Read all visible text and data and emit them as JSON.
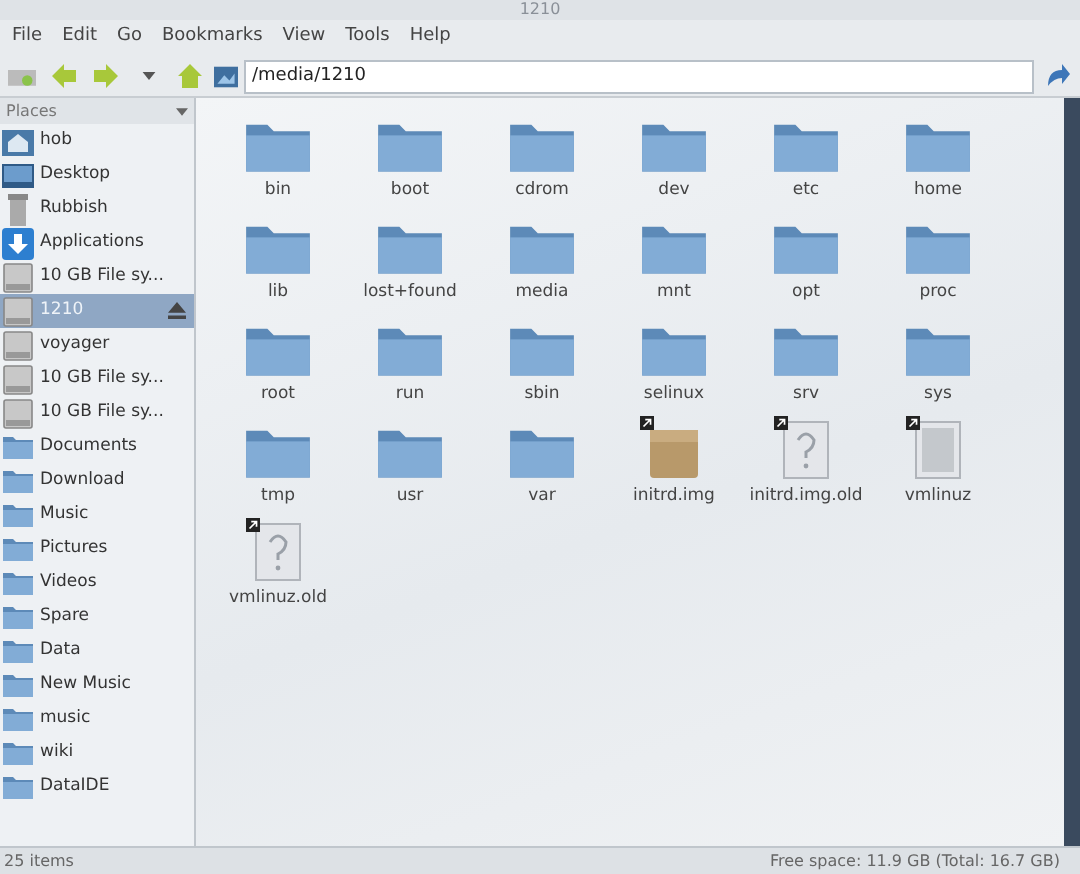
{
  "window": {
    "title": "1210"
  },
  "menu": [
    "File",
    "Edit",
    "Go",
    "Bookmarks",
    "View",
    "Tools",
    "Help"
  ],
  "location": {
    "value": "/media/1210"
  },
  "sidebar": {
    "title": "Places",
    "items": [
      {
        "label": "hob",
        "kind": "home",
        "selected": false
      },
      {
        "label": "Desktop",
        "kind": "desktop",
        "selected": false
      },
      {
        "label": "Rubbish",
        "kind": "trash",
        "selected": false
      },
      {
        "label": "Applications",
        "kind": "apps",
        "selected": false
      },
      {
        "label": "10 GB File sy...",
        "kind": "drive",
        "selected": false
      },
      {
        "label": "1210",
        "kind": "drive",
        "selected": true,
        "eject": true
      },
      {
        "label": "voyager",
        "kind": "drive",
        "selected": false
      },
      {
        "label": "10 GB File sy...",
        "kind": "drive",
        "selected": false
      },
      {
        "label": "10 GB File sy...",
        "kind": "drive",
        "selected": false
      },
      {
        "label": "Documents",
        "kind": "folder",
        "selected": false
      },
      {
        "label": "Download",
        "kind": "folder",
        "selected": false
      },
      {
        "label": "Music",
        "kind": "folder",
        "selected": false
      },
      {
        "label": "Pictures",
        "kind": "folder",
        "selected": false
      },
      {
        "label": "Videos",
        "kind": "folder",
        "selected": false
      },
      {
        "label": "Spare",
        "kind": "folder",
        "selected": false
      },
      {
        "label": "Data",
        "kind": "folder",
        "selected": false
      },
      {
        "label": "New Music",
        "kind": "folder",
        "selected": false
      },
      {
        "label": "music",
        "kind": "folder",
        "selected": false
      },
      {
        "label": "wiki",
        "kind": "folder",
        "selected": false
      },
      {
        "label": "DataIDE",
        "kind": "folder",
        "selected": false
      }
    ]
  },
  "files": [
    {
      "name": "bin",
      "kind": "folder",
      "link": false
    },
    {
      "name": "boot",
      "kind": "folder",
      "link": false
    },
    {
      "name": "cdrom",
      "kind": "folder",
      "link": false
    },
    {
      "name": "dev",
      "kind": "folder",
      "link": false
    },
    {
      "name": "etc",
      "kind": "folder",
      "link": false
    },
    {
      "name": "home",
      "kind": "folder",
      "link": false
    },
    {
      "name": "lib",
      "kind": "folder",
      "link": false
    },
    {
      "name": "lost+found",
      "kind": "folder",
      "link": false
    },
    {
      "name": "media",
      "kind": "folder",
      "link": false
    },
    {
      "name": "mnt",
      "kind": "folder",
      "link": false
    },
    {
      "name": "opt",
      "kind": "folder",
      "link": false
    },
    {
      "name": "proc",
      "kind": "folder",
      "link": false
    },
    {
      "name": "root",
      "kind": "folder",
      "link": false
    },
    {
      "name": "run",
      "kind": "folder",
      "link": false
    },
    {
      "name": "sbin",
      "kind": "folder",
      "link": false
    },
    {
      "name": "selinux",
      "kind": "folder",
      "link": false
    },
    {
      "name": "srv",
      "kind": "folder",
      "link": false
    },
    {
      "name": "sys",
      "kind": "folder",
      "link": false
    },
    {
      "name": "tmp",
      "kind": "folder",
      "link": false
    },
    {
      "name": "usr",
      "kind": "folder",
      "link": false
    },
    {
      "name": "var",
      "kind": "folder",
      "link": false
    },
    {
      "name": "initrd.img",
      "kind": "package",
      "link": true
    },
    {
      "name": "initrd.img.old",
      "kind": "unknown",
      "link": true
    },
    {
      "name": "vmlinuz",
      "kind": "binary",
      "link": true
    },
    {
      "name": "vmlinuz.old",
      "kind": "unknown",
      "link": true
    }
  ],
  "status_bar": {
    "items": "25 items",
    "free_space": "Free space: 11.9 GB (Total: 16.7 GB)"
  }
}
